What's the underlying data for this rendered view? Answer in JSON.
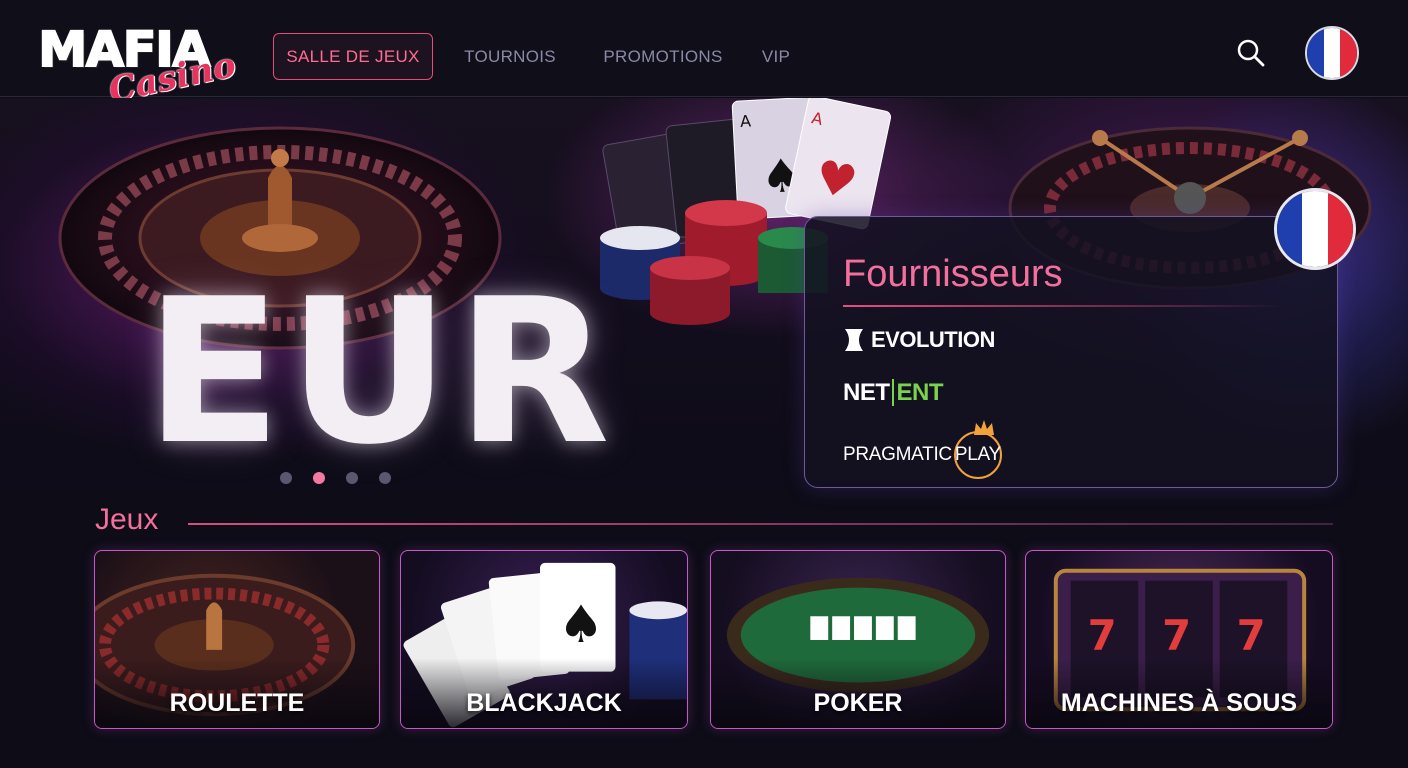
{
  "brand": {
    "logo_main": "MAFIA",
    "logo_sub": "Casino"
  },
  "nav": {
    "items": [
      {
        "label": "SALLE DE JEUX",
        "active": true
      },
      {
        "label": "TOURNOIS",
        "active": false
      },
      {
        "label": "PROMOTIONS",
        "active": false
      },
      {
        "label": "VIP",
        "active": false
      }
    ]
  },
  "header": {
    "search_icon": "search-icon",
    "language_flag": "france-flag-icon"
  },
  "hero": {
    "currency": "EUR",
    "carousel": {
      "slides": 4,
      "active_index": 1
    }
  },
  "providers": {
    "title": "Fournisseurs",
    "items": [
      {
        "name": "EVOLUTION"
      },
      {
        "name_a": "NET",
        "name_b": "ENT"
      },
      {
        "name_a": "PRAGMATIC",
        "name_b": "PLAY"
      }
    ]
  },
  "games": {
    "title": "Jeux",
    "items": [
      {
        "label": "ROULETTE"
      },
      {
        "label": "BLACKJACK"
      },
      {
        "label": "POKER"
      },
      {
        "label": "MACHINES À SOUS"
      }
    ]
  },
  "colors": {
    "accent_pink": "#f36f9c",
    "nav_active": "#ff6d92",
    "background": "#0d0c17",
    "card_border": "#c45ac8",
    "netent_green": "#79d34d",
    "pragmatic_orange": "#f3a13b"
  }
}
